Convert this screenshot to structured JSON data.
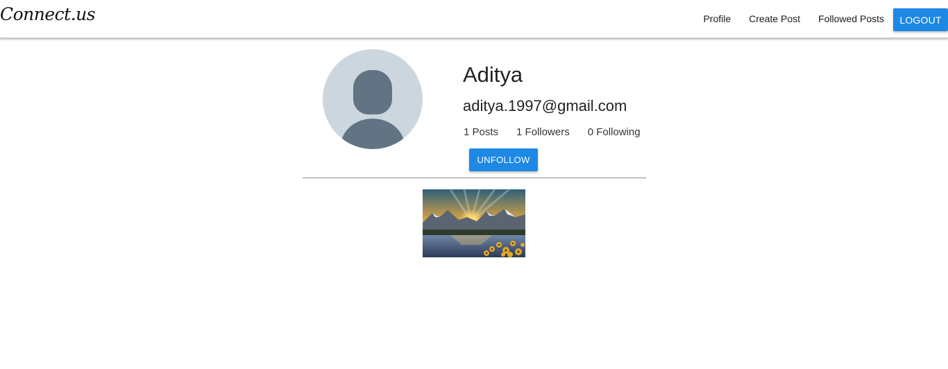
{
  "navbar": {
    "brand": "Connect.us",
    "links": [
      {
        "label": "Profile"
      },
      {
        "label": "Create Post"
      },
      {
        "label": "Followed Posts"
      }
    ],
    "logout_label": "LOGOUT"
  },
  "profile": {
    "avatar_icon": "user-placeholder-icon",
    "name": "Aditya",
    "email": "aditya.1997@gmail.com",
    "stats": {
      "posts": "1 Posts",
      "followers": "1 Followers",
      "following": "0 Following"
    },
    "unfollow_label": "UNFOLLOW"
  },
  "colors": {
    "accent": "#1e88e5",
    "avatar_bg": "#cbd6de",
    "avatar_fg": "#627384"
  }
}
